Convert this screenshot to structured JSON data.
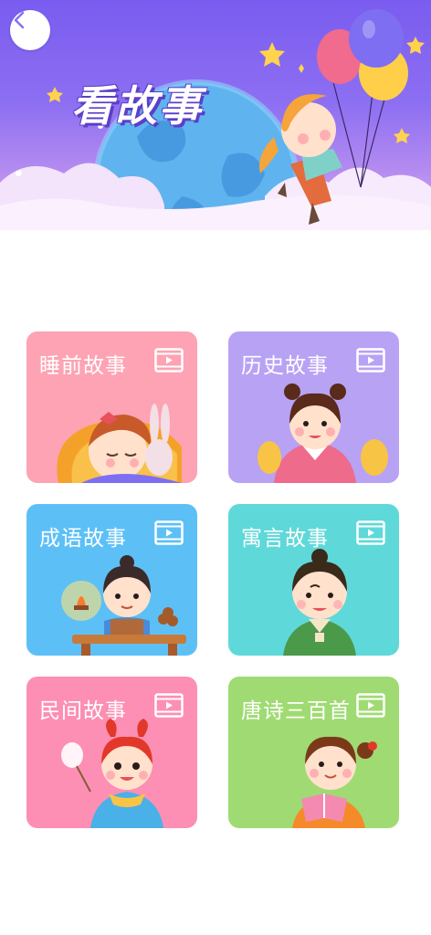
{
  "header": {
    "title": "看故事",
    "back_icon": "chevron-left-icon"
  },
  "categories": [
    {
      "label": "睡前故事",
      "color": "#fda3b4",
      "icon": "video-icon"
    },
    {
      "label": "历史故事",
      "color": "#b8a2f4",
      "icon": "video-icon"
    },
    {
      "label": "成语故事",
      "color": "#5cc0f7",
      "icon": "video-icon"
    },
    {
      "label": "寓言故事",
      "color": "#5fd8d9",
      "icon": "video-icon"
    },
    {
      "label": "民间故事",
      "color": "#fc8fb3",
      "icon": "video-icon"
    },
    {
      "label": "唐诗三百首",
      "color": "#9fdb72",
      "icon": "video-icon"
    }
  ]
}
